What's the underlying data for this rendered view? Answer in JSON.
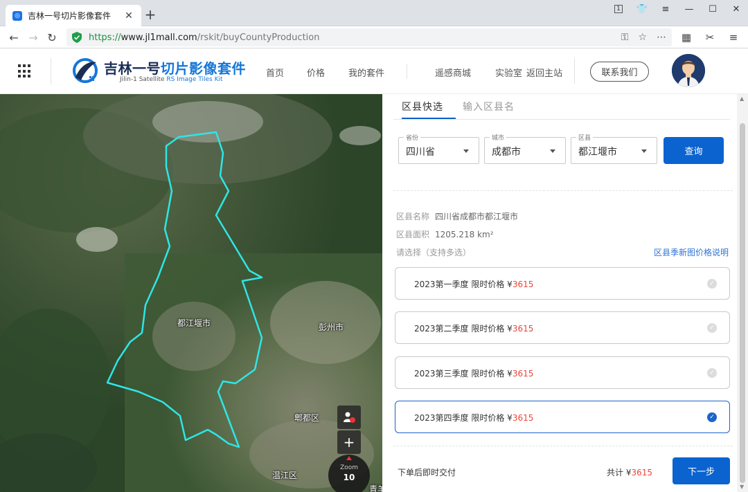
{
  "browser": {
    "tab_title": "吉林一号切片影像套件",
    "tab_icon": "site-favicon",
    "new_tab": "+",
    "url_scheme": "https://",
    "url_host": "www.jl1mall.com",
    "url_path": "/rskit/buyCountyProduction",
    "window_badge": "1"
  },
  "header": {
    "logo_main": "吉林一号",
    "logo_highlight": "切片影像套件",
    "logo_sub_a": "Jilin-1  Satellite ",
    "logo_sub_b": "RS Image Tiles Kit",
    "nav": [
      "首页",
      "价格",
      "我的套件",
      "遥感商城",
      "实验室",
      "返回主站"
    ],
    "contact": "联系我们"
  },
  "map": {
    "labels": [
      "都江堰市",
      "彭州市",
      "郫都区",
      "温江区",
      "青羊"
    ],
    "zoom_label": "Zoom",
    "zoom_value": "10",
    "zoom_in": "+",
    "boundary_color": "#2ee6e6"
  },
  "panel": {
    "tabs": [
      "区县快选",
      "输入区县名"
    ],
    "selects": [
      {
        "caption": "省份",
        "value": "四川省"
      },
      {
        "caption": "城市",
        "value": "成都市"
      },
      {
        "caption": "区县",
        "value": "都江堰市"
      }
    ],
    "query_button": "查询",
    "county_name_label": "区县名称",
    "county_name_value": "四川省成都市都江堰市",
    "county_area_label": "区县面积",
    "county_area_value": "1205.218  km²",
    "select_hint": "请选择（支持多选）",
    "price_link": "区县季新图价格说明",
    "options": [
      {
        "label": "2023第一季度 限时价格 ¥",
        "price": "3615",
        "selected": false
      },
      {
        "label": "2023第二季度 限时价格 ¥",
        "price": "3615",
        "selected": false
      },
      {
        "label": "2023第三季度 限时价格 ¥",
        "price": "3615",
        "selected": false
      },
      {
        "label": "2023第四季度 限时价格 ¥",
        "price": "3615",
        "selected": true
      }
    ],
    "footer_note": "下单后即时交付",
    "total_label": "共计 ¥",
    "total_value": "3615",
    "next_button": "下一步"
  },
  "colors": {
    "primary": "#0b63d0",
    "price": "#e9453a",
    "boundary": "#2ee6e6"
  }
}
